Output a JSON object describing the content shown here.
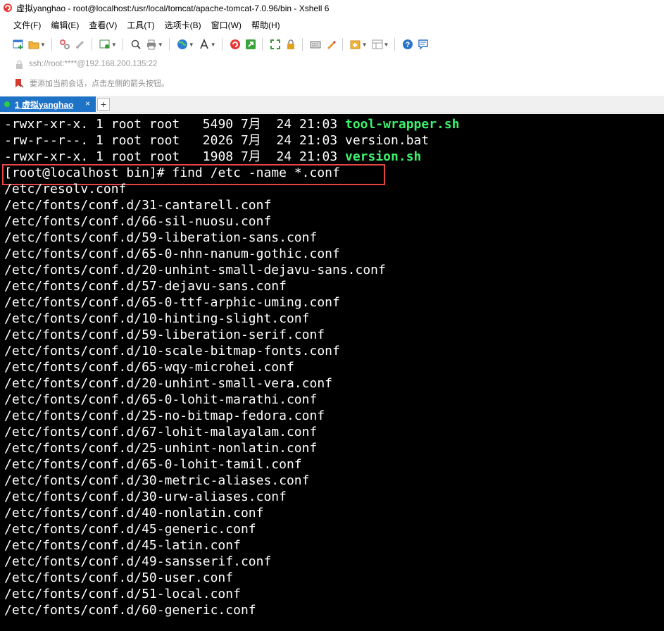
{
  "window": {
    "title": "虚拟yanghao - root@localhost:/usr/local/tomcat/apache-tomcat-7.0.96/bin - Xshell 6"
  },
  "menu": {
    "items": [
      {
        "label": "文件(F)"
      },
      {
        "label": "编辑(E)"
      },
      {
        "label": "查看(V)"
      },
      {
        "label": "工具(T)"
      },
      {
        "label": "选项卡(B)"
      },
      {
        "label": "窗口(W)"
      },
      {
        "label": "帮助(H)"
      }
    ]
  },
  "address": {
    "text": "ssh://root:****@192.168.200.135:22"
  },
  "hint": {
    "text": "要添加当前会话，点击左侧的箭头按钮。"
  },
  "tabs": [
    {
      "label": "1 虚拟yanghao",
      "close": "×",
      "status_color": "#27d13c"
    }
  ],
  "tab_add_label": "+",
  "terminal": {
    "ls_rows": [
      {
        "perms": "-rwxr-xr-x.",
        "links": "1",
        "owner": "root",
        "group": "root",
        "size": "5490",
        "month": "7月",
        "day": "24",
        "time": "21:03",
        "name": "tool-wrapper.sh",
        "executable": true
      },
      {
        "perms": "-rw-r--r--.",
        "links": "1",
        "owner": "root",
        "group": "root",
        "size": "2026",
        "month": "7月",
        "day": "24",
        "time": "21:03",
        "name": "version.bat",
        "executable": false
      },
      {
        "perms": "-rwxr-xr-x.",
        "links": "1",
        "owner": "root",
        "group": "root",
        "size": "1908",
        "month": "7月",
        "day": "24",
        "time": "21:03",
        "name": "version.sh",
        "executable": true
      }
    ],
    "prompt": "[root@localhost bin]# ",
    "command": "find /etc -name *.conf",
    "output": [
      "/etc/resolv.conf",
      "/etc/fonts/conf.d/31-cantarell.conf",
      "/etc/fonts/conf.d/66-sil-nuosu.conf",
      "/etc/fonts/conf.d/59-liberation-sans.conf",
      "/etc/fonts/conf.d/65-0-nhn-nanum-gothic.conf",
      "/etc/fonts/conf.d/20-unhint-small-dejavu-sans.conf",
      "/etc/fonts/conf.d/57-dejavu-sans.conf",
      "/etc/fonts/conf.d/65-0-ttf-arphic-uming.conf",
      "/etc/fonts/conf.d/10-hinting-slight.conf",
      "/etc/fonts/conf.d/59-liberation-serif.conf",
      "/etc/fonts/conf.d/10-scale-bitmap-fonts.conf",
      "/etc/fonts/conf.d/65-wqy-microhei.conf",
      "/etc/fonts/conf.d/20-unhint-small-vera.conf",
      "/etc/fonts/conf.d/65-0-lohit-marathi.conf",
      "/etc/fonts/conf.d/25-no-bitmap-fedora.conf",
      "/etc/fonts/conf.d/67-lohit-malayalam.conf",
      "/etc/fonts/conf.d/25-unhint-nonlatin.conf",
      "/etc/fonts/conf.d/65-0-lohit-tamil.conf",
      "/etc/fonts/conf.d/30-metric-aliases.conf",
      "/etc/fonts/conf.d/30-urw-aliases.conf",
      "/etc/fonts/conf.d/40-nonlatin.conf",
      "/etc/fonts/conf.d/45-generic.conf",
      "/etc/fonts/conf.d/45-latin.conf",
      "/etc/fonts/conf.d/49-sansserif.conf",
      "/etc/fonts/conf.d/50-user.conf",
      "/etc/fonts/conf.d/51-local.conf",
      "/etc/fonts/conf.d/60-generic.conf"
    ]
  },
  "colors": {
    "terminal_bg": "#000000",
    "terminal_fg": "#ffffff",
    "executable_fg": "#3df16b",
    "tab_active": "#1f73c6",
    "highlight_border": "#e64545"
  },
  "toolbar_icons": [
    "new-session-icon",
    "open-folder-icon",
    "disconnect-icon",
    "reconnect-icon",
    "properties-icon",
    "find-icon",
    "print-icon",
    "globe-icon",
    "font-icon",
    "xshell-icon",
    "xftp-icon",
    "fullscreen-icon",
    "lock-icon",
    "keyboard-icon",
    "highlight-icon",
    "new-tab-icon",
    "layout-icon",
    "help-icon",
    "chat-icon"
  ]
}
